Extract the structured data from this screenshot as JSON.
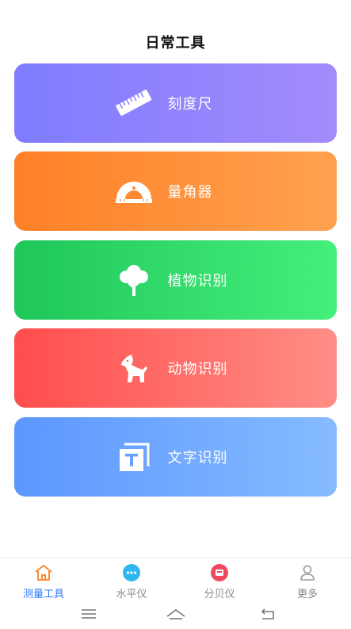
{
  "header": {
    "title": "日常工具"
  },
  "cards": [
    {
      "label": "刻度尺",
      "icon": "ruler-icon",
      "gradient": [
        "#7f7cff",
        "#a38bfb"
      ]
    },
    {
      "label": "量角器",
      "icon": "protractor-icon",
      "gradient": [
        "#ff8026",
        "#ffa14f"
      ]
    },
    {
      "label": "植物识别",
      "icon": "tree-icon",
      "gradient": [
        "#1fc75a",
        "#45ef7b"
      ]
    },
    {
      "label": "动物识别",
      "icon": "dog-icon",
      "gradient": [
        "#ff4d4d",
        "#ff8e86"
      ]
    },
    {
      "label": "文字识别",
      "icon": "text-recognition-icon",
      "gradient": [
        "#5c97ff",
        "#86bbff"
      ]
    }
  ],
  "tabs": [
    {
      "label": "测量工具",
      "icon": "home-icon",
      "active": true
    },
    {
      "label": "水平仪",
      "icon": "level-icon",
      "active": false
    },
    {
      "label": "分贝仪",
      "icon": "decibel-icon",
      "active": false
    },
    {
      "label": "更多",
      "icon": "user-icon",
      "active": false
    }
  ],
  "colors": {
    "accent": "#2f7bff",
    "tab_inactive": "#888888"
  }
}
